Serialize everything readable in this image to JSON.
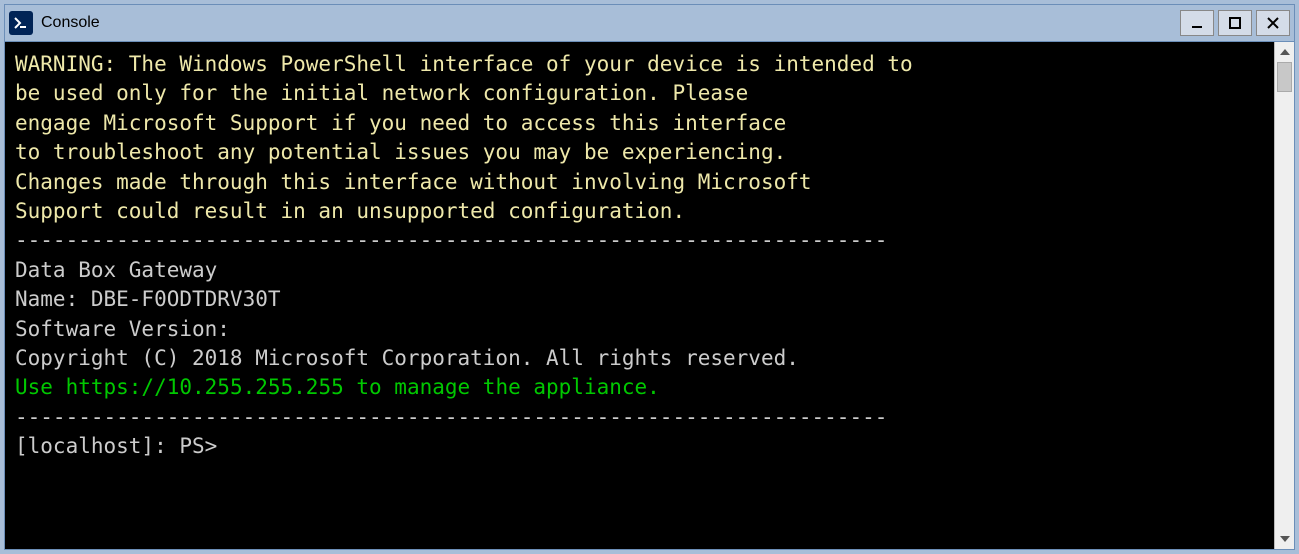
{
  "window": {
    "title": "Console"
  },
  "console": {
    "warning_line1": "WARNING: The Windows PowerShell interface of your device is intended to",
    "warning_line2": "be used only for the initial network configuration. Please",
    "warning_line3": "engage Microsoft Support if you need to access this interface",
    "warning_line4": "to troubleshoot any potential issues you may be experiencing.",
    "warning_line5": "Changes made through this interface without involving Microsoft",
    "warning_line6": "Support could result in an unsupported configuration.",
    "separator1": "---------------------------------------------------------------------",
    "product": "Data Box Gateway",
    "name_line": "Name: DBE-F0ODTDRV30T",
    "software_version": "Software Version:",
    "copyright": "Copyright (C) 2018 Microsoft Corporation. All rights reserved.",
    "manage_prefix": "Use ",
    "manage_url": "https://10.255.255.255",
    "manage_suffix": " to manage the appliance.",
    "separator2": "---------------------------------------------------------------------",
    "prompt": "[localhost]: PS>"
  }
}
